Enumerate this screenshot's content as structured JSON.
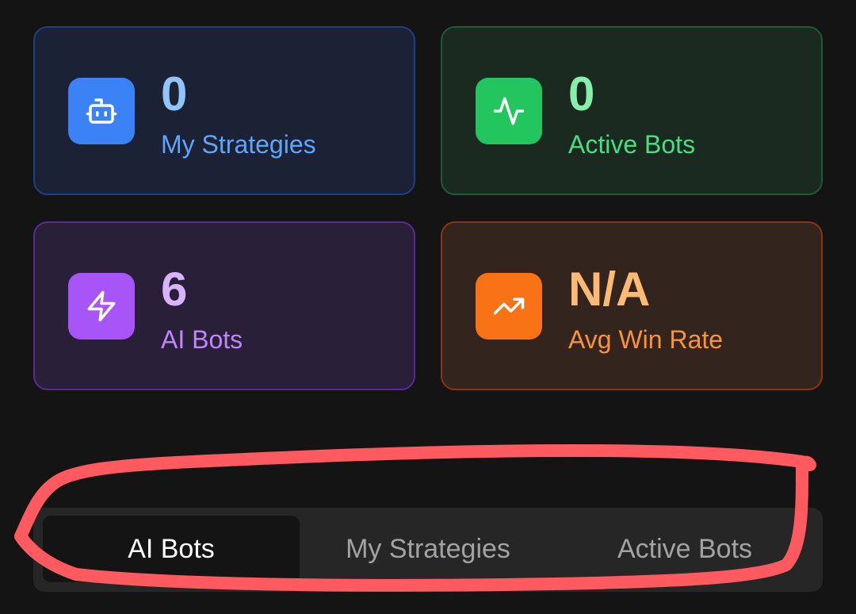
{
  "stats": [
    {
      "value": "0",
      "label": "My Strategies",
      "icon": "robot-icon"
    },
    {
      "value": "0",
      "label": "Active Bots",
      "icon": "activity-icon"
    },
    {
      "value": "6",
      "label": "AI Bots",
      "icon": "lightning-icon"
    },
    {
      "value": "N/A",
      "label": "Avg Win Rate",
      "icon": "trending-up-icon"
    }
  ],
  "tabs": [
    {
      "label": "AI Bots",
      "selected": true
    },
    {
      "label": "My Strategies",
      "selected": false
    },
    {
      "label": "Active Bots",
      "selected": false
    }
  ],
  "colors": {
    "background": "#141414",
    "blue": "#3b82f6",
    "green": "#22c55e",
    "purple": "#a855f7",
    "orange": "#f97316",
    "annotation": "#ff5a5f"
  }
}
